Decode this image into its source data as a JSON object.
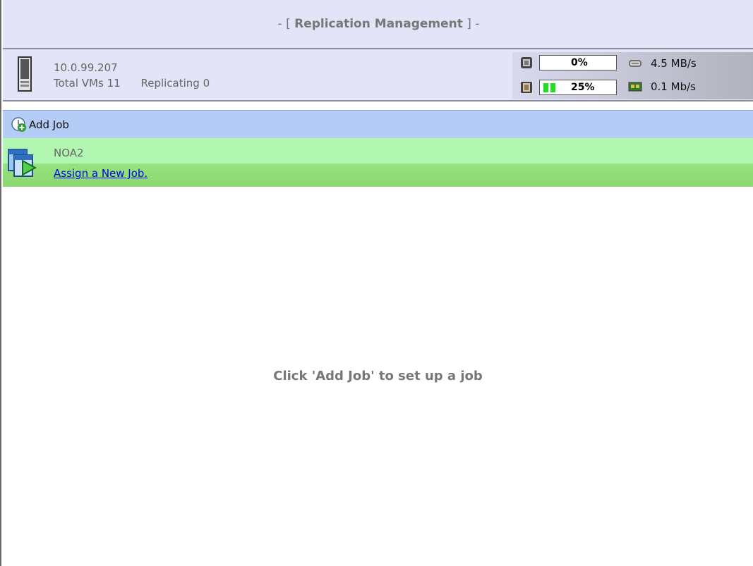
{
  "header": {
    "title_prefix": "- [",
    "title": "Replication Management",
    "title_suffix": "] -"
  },
  "server": {
    "ip": "10.0.99.207",
    "total_vms_label": "Total VMs 11",
    "replicating_label": "Replicating 0",
    "icon": "server-icon"
  },
  "stats": {
    "cpu_percent": "0%",
    "cpu_fraction": 0.0,
    "memory_percent": "25%",
    "memory_fraction": 0.25,
    "disk_rate": "4.5 MB/s",
    "network_rate": "0.1 Mb/s",
    "cpu_icon": "cpu-chip-icon",
    "memory_icon": "memory-chip-icon",
    "disk_icon": "disk-drive-icon",
    "network_icon": "network-card-icon",
    "bar_color": "#22dd22"
  },
  "toolbar": {
    "add_job_label": "Add Job",
    "add_job_icon": "add-job-icon"
  },
  "jobs": [
    {
      "name": "NOA2",
      "action_link": "Assign a New Job.",
      "icon": "replication-job-icon"
    }
  ],
  "empty_state": {
    "message": "Click 'Add Job' to set up a job"
  },
  "colors": {
    "header_bg": "#e3e4f7",
    "toolbar_bg": "#b3cdf6",
    "job_row_bg": "#b2f7b1",
    "link": "#0000ee"
  }
}
